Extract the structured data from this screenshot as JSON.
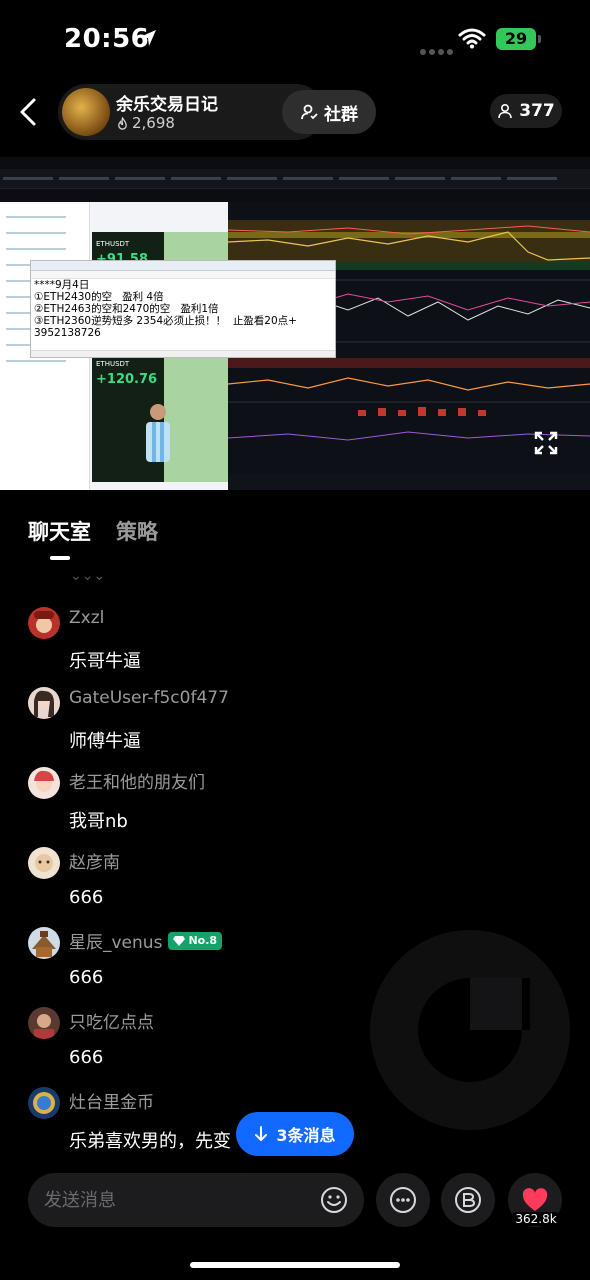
{
  "status_bar": {
    "time": "20:56",
    "battery": "29"
  },
  "header": {
    "channel_name": "余乐交易日记",
    "followers": "2,698",
    "community_label": "社群",
    "viewers": "377"
  },
  "video": {
    "note_lines": [
      "****9月4日",
      "①ETH2430的空   盈利 4倍",
      "②ETH2463的空和2470的空   盈利1倍",
      "③ETH2360逆势短多 2354必须止损！！  止盈看20点+",
      "3952138726"
    ],
    "phone_symbol_1": "ETHUSDT",
    "phone_symbol_2": "ETHUSDT",
    "phone_value_1": "+91.58",
    "phone_value_2": "+120.76"
  },
  "tabs": {
    "chat": "聊天室",
    "strategy": "策略"
  },
  "messages": [
    {
      "user": "Zxzl",
      "text": "乐哥牛逼",
      "avatar_color": "#c0392b"
    },
    {
      "user": "GateUser-f5c0f477",
      "text": "师傅牛逼",
      "avatar_color": "#e8d2c8"
    },
    {
      "user": "老王和他的朋友们",
      "text": "我哥nb",
      "avatar_color": "#d65a5a"
    },
    {
      "user": "赵彦南",
      "text": "666",
      "avatar_color": "#d9c2a0"
    },
    {
      "user": "星辰_venus",
      "text": "666",
      "avatar_color": "#b3874a",
      "badge": "No.8"
    },
    {
      "user": "只吃亿点点",
      "text": "666",
      "avatar_color": "#8a4a3a"
    },
    {
      "user": "灶台里金币",
      "text": "乐弟喜欢男的，先变",
      "avatar_color": "#3a6fb0"
    }
  ],
  "new_messages_label": "3条消息",
  "input": {
    "placeholder": "发送消息"
  },
  "like_count": "362.8k",
  "icons": [
    "back-arrow-icon",
    "location-arrow-icon",
    "wifi-icon",
    "fire-icon",
    "community-icon",
    "person-icon",
    "fullscreen-icon",
    "emoji-icon",
    "more-icon",
    "b-coin-icon",
    "heart-icon",
    "arrow-down-icon"
  ]
}
